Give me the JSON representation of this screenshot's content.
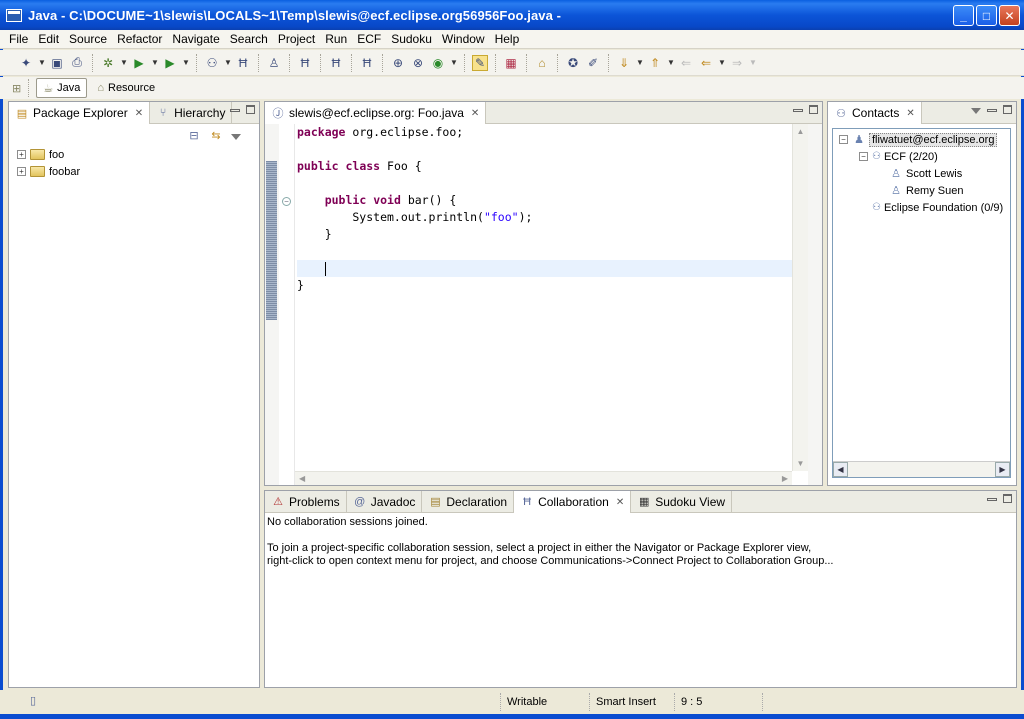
{
  "window": {
    "title": "Java - C:\\DOCUME~1\\slewis\\LOCALS~1\\Temp\\slewis@ecf.eclipse.org56956Foo.java -",
    "min_glyph": "_",
    "max_glyph": "□",
    "close_glyph": "✕"
  },
  "menu": {
    "items": [
      "File",
      "Edit",
      "Source",
      "Refactor",
      "Navigate",
      "Search",
      "Project",
      "Run",
      "ECF",
      "Sudoku",
      "Window",
      "Help"
    ]
  },
  "perspectives": {
    "open_glyph": "⊞",
    "java_label": "Java",
    "resource_label": "Resource"
  },
  "package_explorer": {
    "tab_label": "Package Explorer",
    "hierarchy_tab_label": "Hierarchy",
    "items": [
      {
        "label": "foo"
      },
      {
        "label": "foobar"
      }
    ]
  },
  "editor": {
    "tab_label": "slewis@ecf.eclipse.org: Foo.java",
    "code": {
      "line1_kw": "package",
      "line1_rest": " org.eclipse.foo;",
      "line3_kw1": "public",
      "line3_kw2": "class",
      "line3_rest": " Foo {",
      "line5_indent": "    ",
      "line5_kw1": "public",
      "line5_kw2": "void",
      "line5_rest": " bar() {",
      "line6_pre": "        System.out.println(",
      "line6_str": "\"foo\"",
      "line6_post": ");",
      "line7": "    }",
      "line9_indent": "    ",
      "line10": "}"
    }
  },
  "contacts": {
    "tab_label": "Contacts",
    "account": "fliwatuet@ecf.eclipse.org",
    "groups": [
      {
        "label": "ECF (2/20)",
        "members": [
          "Scott Lewis",
          "Remy Suen"
        ]
      },
      {
        "label": "Eclipse Foundation (0/9)",
        "members": []
      }
    ]
  },
  "bottom": {
    "tabs": [
      "Problems",
      "Javadoc",
      "Declaration",
      "Collaboration",
      "Sudoku View"
    ],
    "active_tab": "Collaboration",
    "line1": "No collaboration sessions joined.",
    "line2": "To join a project-specific collaboration session, select a project in either the Navigator or Package Explorer view,",
    "line3": "right-click to open context menu for project, and choose Communications->Connect Project to Collaboration Group..."
  },
  "status": {
    "writable": "Writable",
    "insert_mode": "Smart Insert",
    "position": "9 : 5"
  }
}
